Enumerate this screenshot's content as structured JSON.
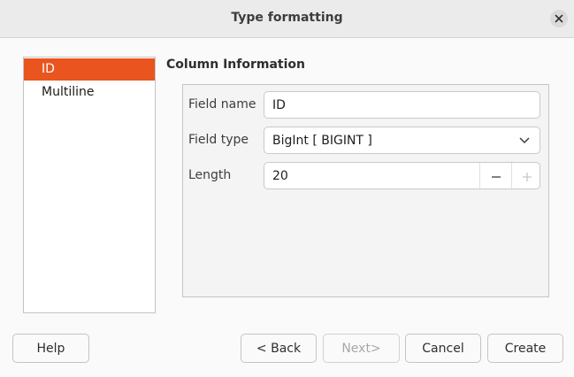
{
  "window": {
    "title": "Type formatting"
  },
  "sidebar": {
    "items": [
      {
        "label": "ID",
        "selected": true
      },
      {
        "label": "Multiline",
        "selected": false
      }
    ]
  },
  "section": {
    "heading": "Column Information"
  },
  "fields": {
    "name_label": "Field name",
    "name_value": "ID",
    "type_label": "Field type",
    "type_value": "BigInt [ BIGINT ]",
    "length_label": "Length",
    "length_value": "20"
  },
  "buttons": {
    "help": "Help",
    "back": "< Back",
    "next": "Next>",
    "cancel": "Cancel",
    "create": "Create"
  },
  "icons": {
    "close": "close-icon",
    "dropdown": "chevron-down-icon",
    "decrement": "minus-icon",
    "increment": "plus-icon"
  },
  "colors": {
    "accent": "#e9541f"
  }
}
